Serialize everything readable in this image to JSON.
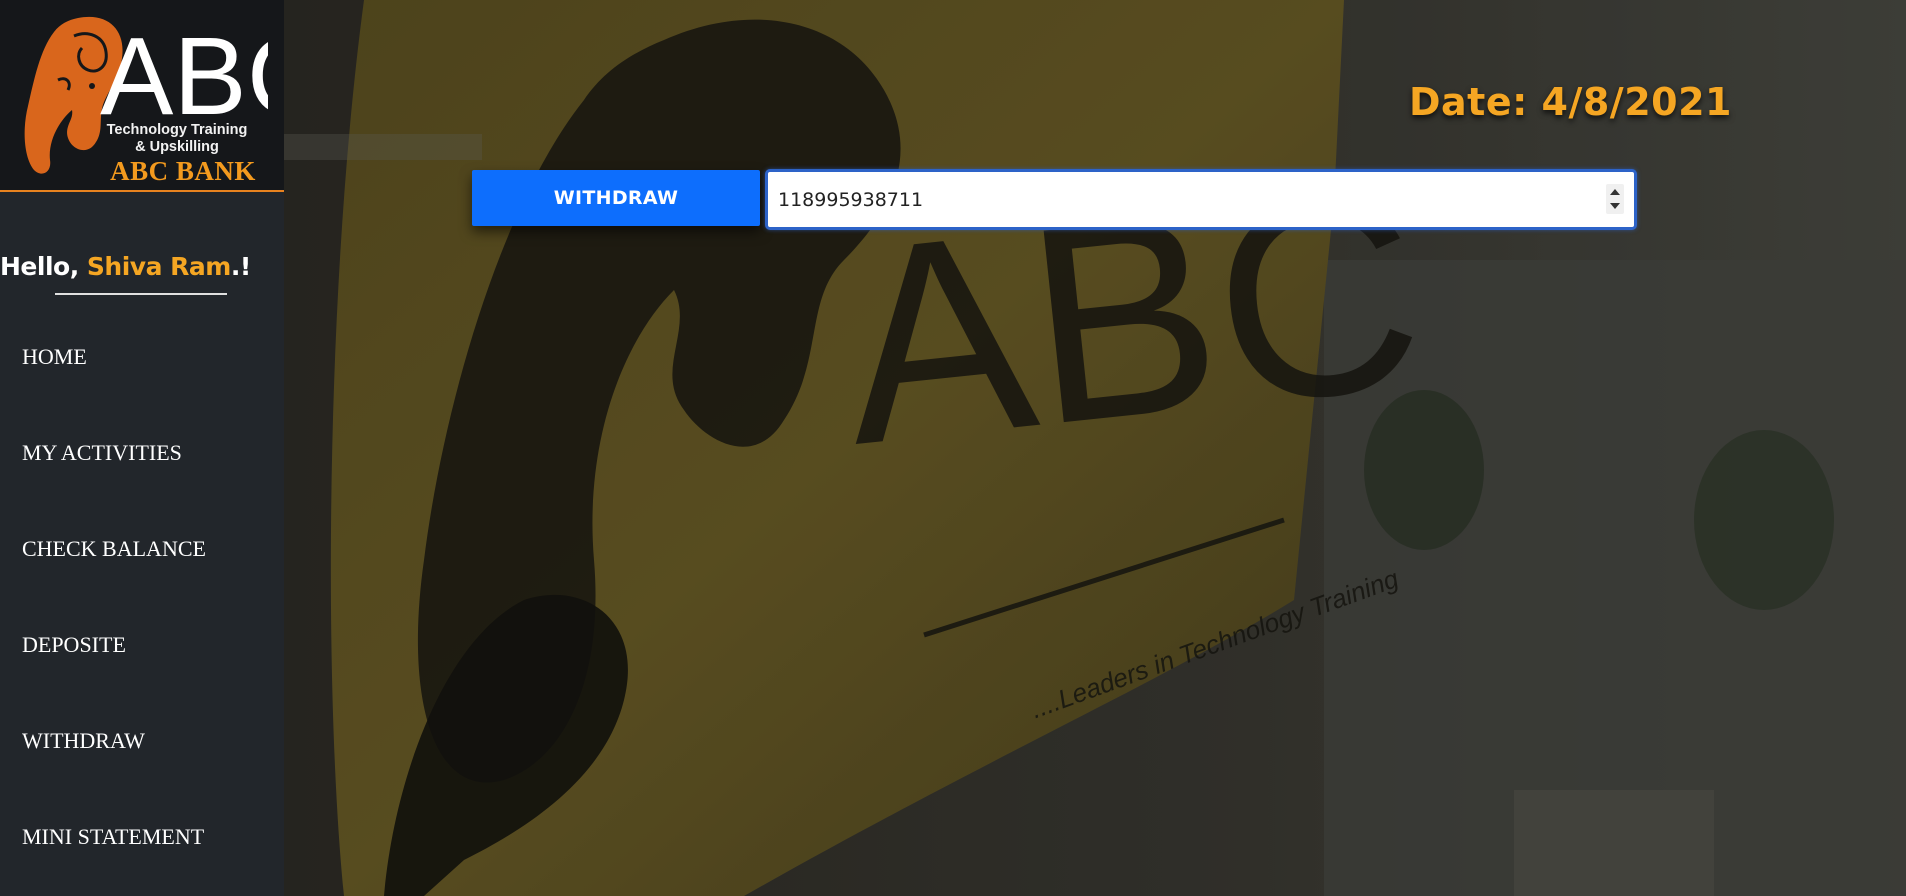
{
  "brand": {
    "logo_letters": "ABC",
    "tagline_line1": "Technology Training",
    "tagline_line2": "& Upskilling",
    "bank_name": "ABC BANK"
  },
  "greeting": {
    "prefix": "Hello, ",
    "name": "Shiva Ram",
    "suffix": ".!"
  },
  "nav": {
    "items": [
      {
        "label": "HOME"
      },
      {
        "label": "MY ACTIVITIES"
      },
      {
        "label": "CHECK BALANCE"
      },
      {
        "label": "DEPOSITE"
      },
      {
        "label": "WITHDRAW"
      },
      {
        "label": "MINI STATEMENT"
      }
    ]
  },
  "header": {
    "date": "Date: 4/8/2021"
  },
  "withdraw": {
    "button_label": "WITHDRAW",
    "amount_value": "118995938711"
  },
  "background": {
    "sign_text": "ABC",
    "sign_tagline": "....Leaders in Technology Training"
  },
  "colors": {
    "accent_orange": "#f5a623",
    "button_blue": "#0d6efd",
    "sidebar_bg": "#22262b"
  }
}
